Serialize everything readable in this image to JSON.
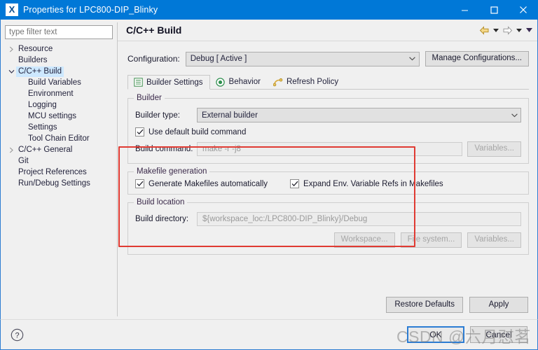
{
  "window": {
    "title": "Properties for LPC800-DIP_Blinky",
    "icon": "X",
    "minimize_label": "Minimize",
    "maximize_label": "Maximize",
    "close_label": "Close"
  },
  "sidebar": {
    "filter_placeholder": "type filter text",
    "filter_value": "",
    "items": [
      {
        "label": "Resource",
        "depth": 1,
        "twisty": "collapsed",
        "selected": false
      },
      {
        "label": "Builders",
        "depth": 1,
        "twisty": "none",
        "selected": false
      },
      {
        "label": "C/C++ Build",
        "depth": 1,
        "twisty": "expanded",
        "selected": true
      },
      {
        "label": "Build Variables",
        "depth": 2,
        "twisty": "none",
        "selected": false
      },
      {
        "label": "Environment",
        "depth": 2,
        "twisty": "none",
        "selected": false
      },
      {
        "label": "Logging",
        "depth": 2,
        "twisty": "none",
        "selected": false
      },
      {
        "label": "MCU settings",
        "depth": 2,
        "twisty": "none",
        "selected": false
      },
      {
        "label": "Settings",
        "depth": 2,
        "twisty": "none",
        "selected": false
      },
      {
        "label": "Tool Chain Editor",
        "depth": 2,
        "twisty": "none",
        "selected": false
      },
      {
        "label": "C/C++ General",
        "depth": 1,
        "twisty": "collapsed",
        "selected": false
      },
      {
        "label": "Git",
        "depth": 1,
        "twisty": "none",
        "selected": false
      },
      {
        "label": "Project References",
        "depth": 1,
        "twisty": "none",
        "selected": false
      },
      {
        "label": "Run/Debug Settings",
        "depth": 1,
        "twisty": "none",
        "selected": false
      }
    ]
  },
  "page": {
    "title": "C/C++ Build",
    "nav": {
      "back_label": "Back",
      "forward_label": "Forward",
      "menu_label": "View Menu"
    }
  },
  "configuration": {
    "label": "Configuration:",
    "value": "Debug  [ Active ]",
    "manage_button": "Manage Configurations..."
  },
  "tabs": [
    {
      "label": "Builder Settings",
      "icon": "list-icon",
      "active": true
    },
    {
      "label": "Behavior",
      "icon": "radio-icon",
      "active": false
    },
    {
      "label": "Refresh Policy",
      "icon": "refresh-icon",
      "active": false
    }
  ],
  "builder_group": {
    "title": "Builder",
    "builder_type_label": "Builder type:",
    "builder_type_value": "External builder",
    "use_default_label": "Use default build command",
    "use_default_checked": true,
    "build_command_label": "Build command:",
    "build_command_value": "make -r -j8",
    "variables_button": "Variables..."
  },
  "makefile_group": {
    "title": "Makefile generation",
    "generate_label": "Generate Makefiles automatically",
    "generate_checked": true,
    "expand_label": "Expand Env. Variable Refs in Makefiles",
    "expand_checked": true
  },
  "build_location_group": {
    "title": "Build location",
    "build_directory_label": "Build directory:",
    "build_directory_value": "${workspace_loc:/LPC800-DIP_Blinky}/Debug",
    "workspace_button": "Workspace...",
    "filesystem_button": "File system...",
    "variables_button": "Variables..."
  },
  "actions": {
    "restore_defaults": "Restore Defaults",
    "apply": "Apply",
    "ok": "OK",
    "cancel": "Cancel",
    "help_label": "Help"
  },
  "annotation": {
    "color": "#e03a32"
  },
  "watermark": {
    "text": "CSDN @六月怼茗"
  }
}
